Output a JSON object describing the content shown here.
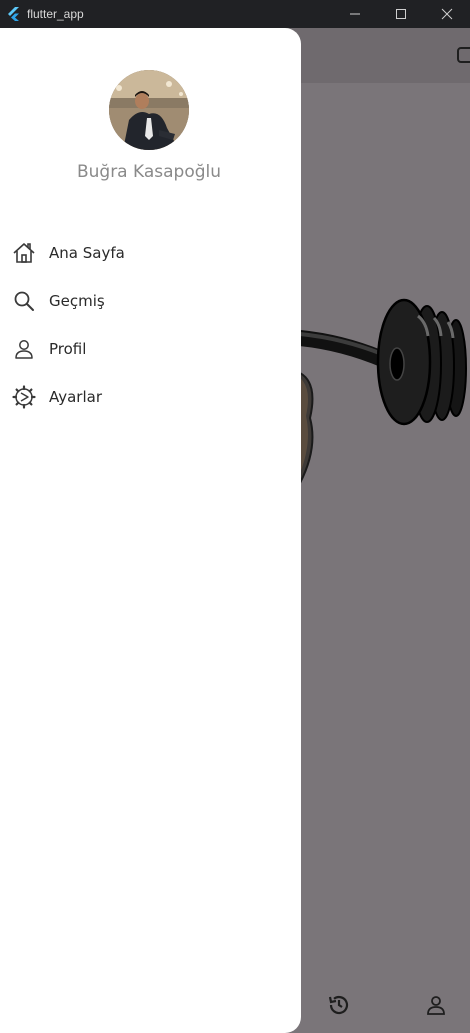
{
  "window": {
    "title": "flutter_app"
  },
  "drawer": {
    "user_name": "Buğra Kasapoğlu",
    "menu": [
      {
        "label": "Ana Sayfa",
        "icon": "home-icon"
      },
      {
        "label": "Geçmiş",
        "icon": "search-icon"
      },
      {
        "label": "Profil",
        "icon": "person-icon"
      },
      {
        "label": "Ayarlar",
        "icon": "settings-icon"
      }
    ]
  },
  "background": {
    "appbar_action_icon": "square-icon",
    "illustration": "barbell",
    "bottom_nav": [
      {
        "icon": "history-icon"
      },
      {
        "icon": "person-icon"
      }
    ]
  },
  "colors": {
    "scrim": "#7a7579",
    "drawer_bg": "#ffffff",
    "titlebar_bg": "#202124",
    "name_text": "#8a8a8a",
    "menu_text": "#2a2a2a"
  }
}
